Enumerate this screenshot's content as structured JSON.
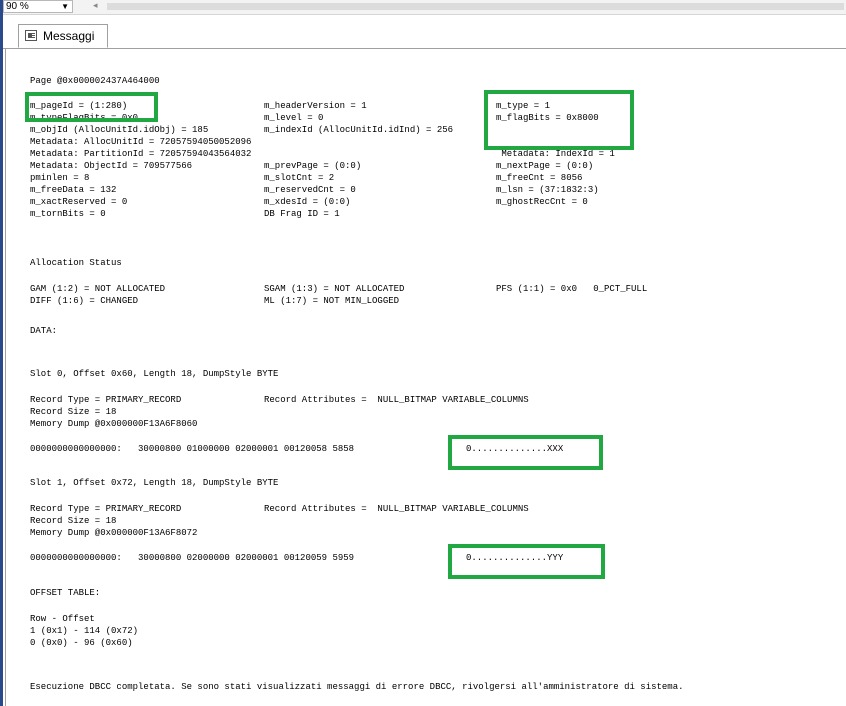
{
  "toolbar": {
    "zoom": "90 %",
    "zoom_arrow": "▼",
    "scroll_left": "◂"
  },
  "tab": {
    "label": "Messaggi"
  },
  "output": {
    "page_header": "Page @0x000002437A464000",
    "header_rows": [
      [
        "m_pageId = (1:280)",
        "m_headerVersion = 1",
        "m_type = 1"
      ],
      [
        "m_typeFlagBits = 0x0",
        "m_level = 0",
        "m_flagBits = 0x8000"
      ],
      [
        "m_objId (AllocUnitId.idObj) = 185",
        "m_indexId (AllocUnitId.idInd) = 256",
        ""
      ],
      [
        "Metadata: AllocUnitId = 72057594050052096",
        "",
        ""
      ],
      [
        "Metadata: PartitionId = 72057594043564032",
        "",
        " Metadata: IndexId = 1"
      ],
      [
        "Metadata: ObjectId = 709577566",
        "m_prevPage = (0:0)",
        "m_nextPage = (0:0)"
      ],
      [
        "pminlen = 8",
        "m_slotCnt = 2",
        "m_freeCnt = 8056"
      ],
      [
        "m_freeData = 132",
        "m_reservedCnt = 0",
        "m_lsn = (37:1832:3)"
      ],
      [
        "m_xactReserved = 0",
        "m_xdesId = (0:0)",
        "m_ghostRecCnt = 0"
      ],
      [
        "m_tornBits = 0",
        "DB Frag ID = 1",
        ""
      ]
    ],
    "allocation_title": "Allocation Status",
    "allocation_rows": [
      [
        "GAM (1:2) = NOT ALLOCATED",
        "SGAM (1:3) = NOT ALLOCATED",
        "PFS (1:1) = 0x0   0_PCT_FULL"
      ],
      [
        "DIFF (1:6) = CHANGED",
        "ML (1:7) = NOT MIN_LOGGED",
        ""
      ]
    ],
    "data_title": "DATA:",
    "slot0": {
      "header": "Slot 0, Offset 0x60, Length 18, DumpStyle BYTE",
      "record_type": "Record Type = PRIMARY_RECORD",
      "record_attributes": "Record Attributes =  NULL_BITMAP VARIABLE_COLUMNS",
      "record_size": "Record Size = 18",
      "memory_dump": "Memory Dump @0x000000F13A6F8060",
      "dump_hex": "0000000000000000:   30000800 01000000 02000001 00120058 5858",
      "dump_ascii": "0..............XXX"
    },
    "slot1": {
      "header": "Slot 1, Offset 0x72, Length 18, DumpStyle BYTE",
      "record_type": "Record Type = PRIMARY_RECORD",
      "record_attributes": "Record Attributes =  NULL_BITMAP VARIABLE_COLUMNS",
      "record_size": "Record Size = 18",
      "memory_dump": "Memory Dump @0x000000F13A6F8072",
      "dump_hex": "0000000000000000:   30000800 02000000 02000001 00120059 5959",
      "dump_ascii": "0..............YYY"
    },
    "offset_title": "OFFSET TABLE:",
    "offset_header": "Row - Offset",
    "offset_rows": [
      "1 (0x1) - 114 (0x72)",
      "0 (0x0) - 96 (0x60)"
    ],
    "completion": "Esecuzione DBCC completata. Se sono stati visualizzati messaggi di errore DBCC, rivolgersi all'amministratore di sistema."
  },
  "colors": {
    "highlight": "#22a843",
    "gutter": "#2b4a8a"
  }
}
